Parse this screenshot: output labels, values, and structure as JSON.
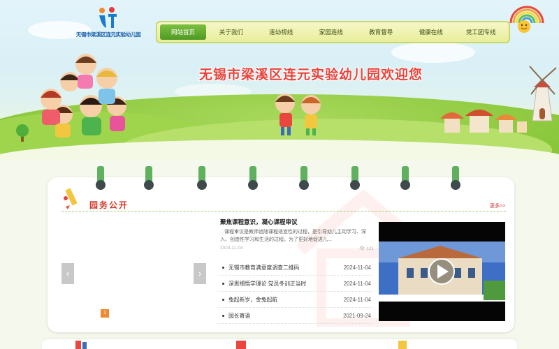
{
  "logo": {
    "text": "无锡市梁溪区连元实验幼儿园"
  },
  "nav": {
    "items": [
      {
        "label": "网站首页"
      },
      {
        "label": "关于我们"
      },
      {
        "label": "连幼视线"
      },
      {
        "label": "家园连线"
      },
      {
        "label": "教育督导"
      },
      {
        "label": "健康在线"
      },
      {
        "label": "党工团专线"
      }
    ],
    "active_index": 0
  },
  "banner": {
    "welcome": "无锡市梁溪区连元实验幼儿园欢迎您"
  },
  "section": {
    "title": "园务公开",
    "more": "更多>>"
  },
  "slider": {
    "prev": "‹",
    "next": "›",
    "current_page": "1"
  },
  "featured": {
    "title": "聚焦课程意识，凝心课程审议",
    "body": "课程审议是教师追随课程适宜性的过程，是引导幼儿主动学习、深入、创造性学习和生活的过程。为了更好地促进儿...",
    "date": "2024-11-04",
    "views": "131"
  },
  "news": [
    {
      "title": "无锡市教育满意度调查二维码",
      "date": "2024-11-04"
    },
    {
      "title": "深思细悟学理论 党员冬训正当时",
      "date": "2024-11-04"
    },
    {
      "title": "兔起新岁，金兔起航",
      "date": "2024-11-04"
    },
    {
      "title": "园长寄语",
      "date": "2021-09-24"
    }
  ],
  "video": {
    "label": "video-player"
  },
  "colors": {
    "nav_active": "#5ca52e",
    "section_title": "#d73a2c",
    "ring": "#5fb15f",
    "accent_orange": "#f08a30"
  }
}
